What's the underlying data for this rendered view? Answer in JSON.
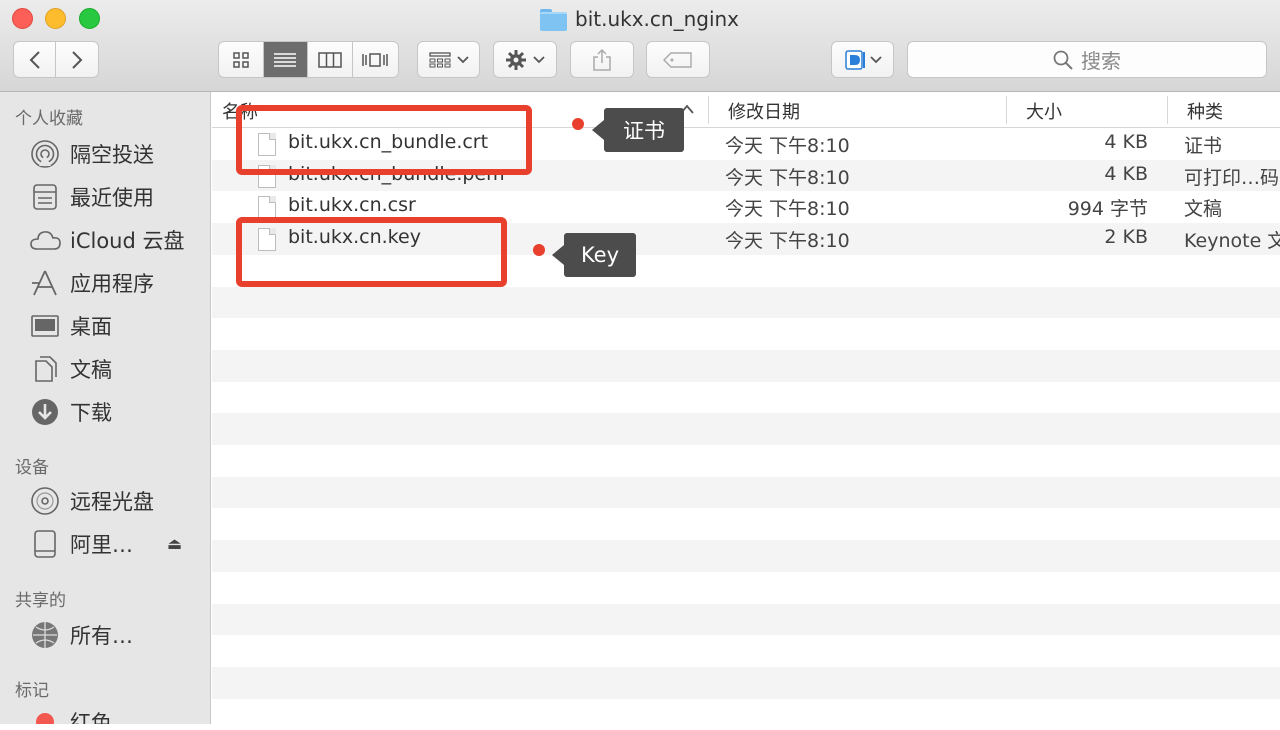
{
  "window": {
    "title": "bit.ukx.cn_nginx"
  },
  "toolbar": {
    "back_icon": "chevron-left-icon",
    "forward_icon": "chevron-right-icon",
    "views": [
      "icon-view",
      "list-view",
      "column-view",
      "cover-flow-view"
    ],
    "active_view": "list-view",
    "search_placeholder": "搜索"
  },
  "sidebar": {
    "sections": [
      {
        "title": "个人收藏",
        "items": [
          {
            "label": "隔空投送",
            "icon": "airdrop-icon"
          },
          {
            "label": "最近使用",
            "icon": "recents-icon"
          },
          {
            "label": "iCloud 云盘",
            "icon": "cloud-icon"
          },
          {
            "label": "应用程序",
            "icon": "applications-icon"
          },
          {
            "label": "桌面",
            "icon": "desktop-icon"
          },
          {
            "label": "文稿",
            "icon": "documents-icon"
          },
          {
            "label": "下载",
            "icon": "downloads-icon"
          }
        ]
      },
      {
        "title": "设备",
        "items": [
          {
            "label": "远程光盘",
            "icon": "disc-icon"
          },
          {
            "label": "阿里…",
            "icon": "drive-icon"
          }
        ]
      },
      {
        "title": "共享的",
        "items": [
          {
            "label": "所有…",
            "icon": "network-icon"
          }
        ]
      },
      {
        "title": "标记",
        "items": [
          {
            "label": "红色",
            "icon": "red-tag-icon"
          }
        ]
      }
    ]
  },
  "columns": {
    "name": "名称",
    "date": "修改日期",
    "size": "大小",
    "kind": "种类"
  },
  "files": [
    {
      "name": "bit.ukx.cn_bundle.crt",
      "date": "今天 下午8:10",
      "size": "4 KB",
      "kind": "证书"
    },
    {
      "name": "bit.ukx.cn_bundle.pem",
      "date": "今天 下午8:10",
      "size": "4 KB",
      "kind": "可打印…码"
    },
    {
      "name": "bit.ukx.cn.csr",
      "date": "今天 下午8:10",
      "size": "994 字节",
      "kind": "文稿"
    },
    {
      "name": "bit.ukx.cn.key",
      "date": "今天 下午8:10",
      "size": "2 KB",
      "kind": "Keynote 文"
    }
  ],
  "annotations": {
    "cert_label": "证书",
    "key_label": "Key",
    "highlight_color": "#e8402c"
  }
}
